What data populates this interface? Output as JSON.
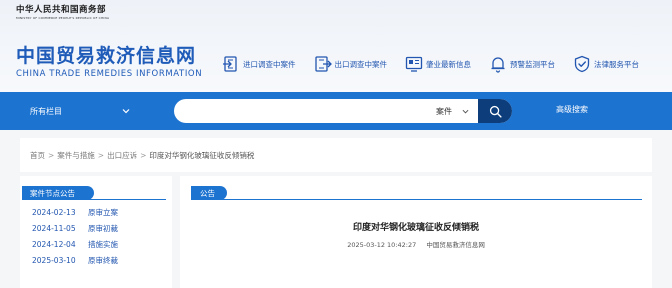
{
  "header": {
    "ministry_cn": "中华人民共和国商务部",
    "ministry_en": "MINISTRY OF COMMERCE PEOPLE'S REPUBLIC OF CHINA",
    "site_title": "中国贸易救济信息网",
    "site_subtitle": "CHINA TRADE REMEDIES INFORMATION",
    "nav": [
      {
        "label": "进口调查中案件",
        "icon": "import-case-icon"
      },
      {
        "label": "出口调查中案件",
        "icon": "export-case-icon"
      },
      {
        "label": "肇业最新信息",
        "icon": "news-monitor-icon"
      },
      {
        "label": "预警监测平台",
        "icon": "bell-icon"
      },
      {
        "label": "法律服务平台",
        "icon": "shield-check-icon"
      }
    ]
  },
  "search": {
    "category": "所有栏目",
    "placeholder": "",
    "value": "",
    "type": "案件",
    "advanced": "高级搜索"
  },
  "breadcrumb": {
    "items": [
      "首页",
      "案件与措施",
      "出口应诉"
    ],
    "current": "印度对华钢化玻璃征收反倾销税"
  },
  "left_panel": {
    "tab": "案件节点公告",
    "items": [
      {
        "date": "2024-02-13",
        "type": "原审立案"
      },
      {
        "date": "2024-11-05",
        "type": "原审初裁"
      },
      {
        "date": "2024-12-04",
        "type": "措施实施"
      },
      {
        "date": "2025-03-10",
        "type": "原审终裁"
      }
    ]
  },
  "notice": {
    "tab": "公告",
    "title": "印度对华钢化玻璃征收反倾销税",
    "datetime": "2025-03-12 10:42:27",
    "source": "中国贸易救济信息网"
  },
  "colors": {
    "brand_blue": "#1d73d0",
    "title_blue": "#1f5bb8",
    "search_button": "#0d3d7a"
  }
}
